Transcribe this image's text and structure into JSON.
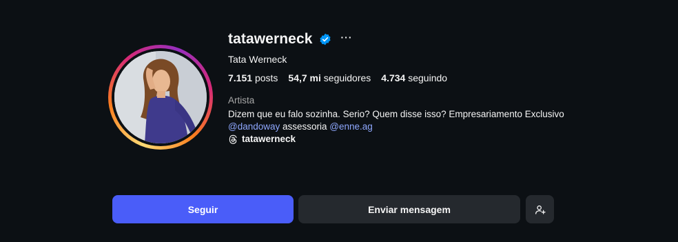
{
  "profile": {
    "username": "tatawerneck",
    "more_label": "···",
    "full_name": "Tata Werneck",
    "stats": {
      "posts_count": "7.151",
      "posts_label": "posts",
      "followers_count": "54,7 mi",
      "followers_label": "seguidores",
      "following_count": "4.734",
      "following_label": "seguindo"
    },
    "category": "Artista",
    "bio_line1": "Dizem que eu falo sozinha. Serio? Quem disse isso? Empresariamento Exclusivo",
    "mention1": "@dandoway",
    "bio_middle": " assessoria ",
    "mention2": "@enne.ag",
    "threads_handle": "tatawerneck"
  },
  "actions": {
    "follow_label": "Seguir",
    "message_label": "Enviar mensagem"
  },
  "colors": {
    "background": "#0c1014",
    "follow_button": "#4a5df9",
    "secondary_button": "#25292e",
    "mention": "#8fa8ff",
    "verified": "#0095f6"
  },
  "icons": {
    "verified": "verified-badge-icon",
    "more": "more-options-icon",
    "threads": "threads-icon",
    "add_person": "add-person-icon"
  }
}
